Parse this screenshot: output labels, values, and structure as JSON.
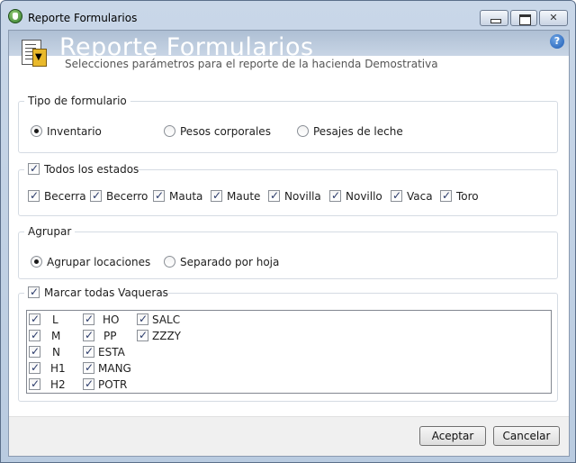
{
  "window": {
    "title": "Reporte Formularios"
  },
  "header": {
    "title": "Reporte Formularios",
    "subtitle": "Selecciones parámetros para el reporte de la hacienda Demostrativa"
  },
  "tipo": {
    "legend": "Tipo de formulario",
    "options": [
      "Inventario",
      "Pesos corporales",
      "Pesajes de leche"
    ],
    "selected": "Inventario"
  },
  "estados": {
    "all_label": "Todos los estados",
    "items": [
      "Becerra",
      "Becerro",
      "Mauta",
      "Maute",
      "Novilla",
      "Novillo",
      "Vaca",
      "Toro"
    ]
  },
  "agrupar": {
    "legend": "Agrupar",
    "options": [
      "Agrupar locaciones",
      "Separado por hoja"
    ],
    "selected": "Agrupar locaciones"
  },
  "vaqueras": {
    "all_label": "Marcar todas Vaqueras",
    "col1": [
      "L",
      "M",
      "N",
      "H1",
      "H2"
    ],
    "col2": [
      "HO",
      "PP",
      "ESTA",
      "MANG",
      "POTR"
    ],
    "col3": [
      "SALC",
      "ZZZY"
    ]
  },
  "footer": {
    "accept": "Aceptar",
    "cancel": "Cancelar"
  }
}
